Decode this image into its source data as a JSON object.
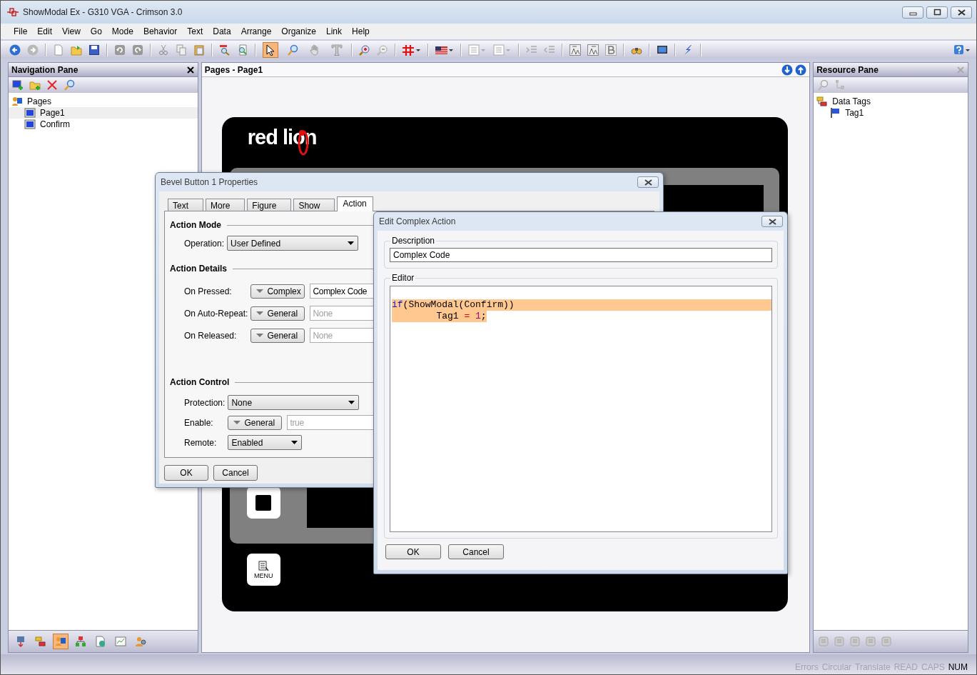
{
  "window": {
    "title": "ShowModal Ex - G310 VGA - Crimson 3.0"
  },
  "menu": [
    "File",
    "Edit",
    "View",
    "Go",
    "Mode",
    "Behavior",
    "Text",
    "Data",
    "Arrange",
    "Organize",
    "Link",
    "Help"
  ],
  "mode_tools": [
    {
      "kind": "pointer",
      "selected": true
    },
    {
      "kind": "zoom",
      "selected": false
    },
    {
      "kind": "pan",
      "selected": false
    },
    {
      "kind": "text",
      "selected": false
    }
  ],
  "navigation_pane": {
    "title": "Navigation Pane",
    "tree": [
      {
        "label": "Pages",
        "children": [
          {
            "label": "Page1",
            "selected": true
          },
          {
            "label": "Confirm",
            "selected": false
          }
        ]
      }
    ],
    "categories": [
      {
        "kind": "comms",
        "selected": false
      },
      {
        "kind": "tags",
        "selected": false
      },
      {
        "kind": "pages",
        "selected": true
      },
      {
        "kind": "programs",
        "selected": false
      },
      {
        "kind": "web",
        "selected": false
      },
      {
        "kind": "logs",
        "selected": false
      },
      {
        "kind": "security",
        "selected": false
      }
    ]
  },
  "editor": {
    "title": "Pages - Page1",
    "logo": "red lion",
    "menu_key": "MENU"
  },
  "resource_pane": {
    "title": "Resource Pane",
    "tree": [
      {
        "label": "Data Tags",
        "children": [
          {
            "label": "Tag1"
          }
        ]
      }
    ]
  },
  "properties_dialog": {
    "title": "Bevel Button 1 Properties",
    "tabs": [
      {
        "label": "Text",
        "selected": false
      },
      {
        "label": "More",
        "selected": false
      },
      {
        "label": "Figure",
        "selected": false
      },
      {
        "label": "Show",
        "selected": false
      },
      {
        "label": "Action",
        "selected": true
      }
    ],
    "sections": [
      {
        "title": "Action Mode",
        "rows": [
          {
            "kind": "select",
            "label": "Operation:",
            "value": "User Defined"
          }
        ]
      },
      {
        "title": "Action Details",
        "rows": [
          {
            "kind": "expression",
            "label": "On Pressed:",
            "mode": "Complex",
            "value": "Complex Code",
            "disabled": false
          },
          {
            "kind": "expression",
            "label": "On Auto-Repeat:",
            "mode": "General",
            "value": "None",
            "disabled": true
          },
          {
            "kind": "expression",
            "label": "On Released:",
            "mode": "General",
            "value": "None",
            "disabled": true
          }
        ]
      },
      {
        "title": "Action Control",
        "rows": [
          {
            "kind": "select",
            "label": "Protection:",
            "value": "None"
          },
          {
            "kind": "expression",
            "label": "Enable:",
            "mode": "General",
            "value": "true",
            "disabled": true
          },
          {
            "kind": "small_select",
            "label": "Remote:",
            "value": "Enabled"
          }
        ]
      }
    ],
    "buttons": [
      "OK",
      "Cancel"
    ]
  },
  "complex_dialog": {
    "title": "Edit Complex Action",
    "description": {
      "label": "Description",
      "value": "Complex Code"
    },
    "editor": {
      "label": "Editor",
      "lines": [
        {
          "selected": true,
          "tokens": [
            {
              "kind": "keyword",
              "text": "if"
            },
            {
              "kind": "plain",
              "text": "(ShowModal(Confirm))"
            }
          ]
        },
        {
          "selected": true,
          "tokens": [
            {
              "kind": "plain",
              "text": "        Tag1 "
            },
            {
              "kind": "operator",
              "text": "= "
            },
            {
              "kind": "number",
              "text": "1"
            },
            {
              "kind": "plain",
              "text": ";"
            }
          ]
        }
      ]
    },
    "buttons": [
      "OK",
      "Cancel"
    ]
  },
  "status_bar": [
    {
      "label": "Errors",
      "on": false
    },
    {
      "label": "Circular",
      "on": false
    },
    {
      "label": "Translate",
      "on": false
    },
    {
      "label": "READ",
      "on": false
    },
    {
      "label": "CAPS",
      "on": false
    },
    {
      "label": "NUM",
      "on": true
    }
  ]
}
